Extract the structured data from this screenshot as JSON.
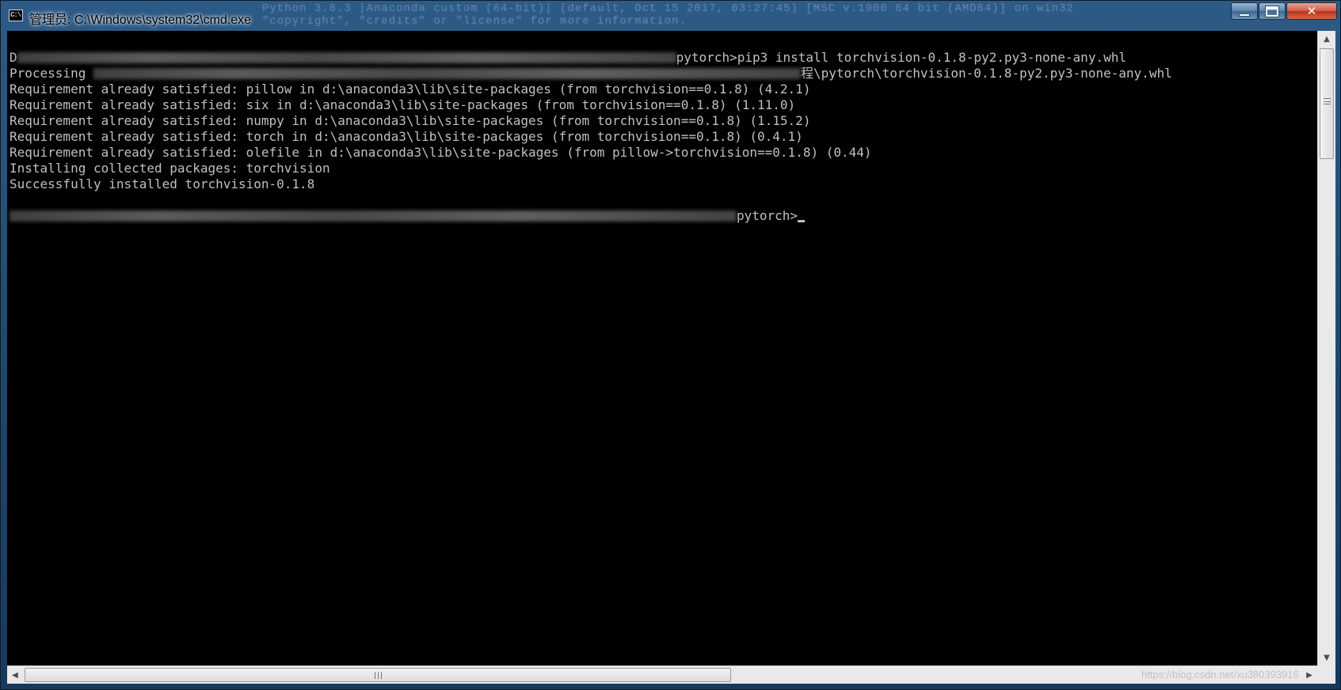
{
  "window": {
    "title": "管理员: C:\\Windows\\system32\\cmd.exe",
    "icon_label": "C:\\",
    "controls": {
      "minimize": "",
      "maximize": "",
      "close": "✕"
    },
    "background_text": "Python 3.6.3 |Anaconda custom (64-bit)| (default, Oct 15 2017, 03:27:45) [MSC v.1900 64 bit (AMD64)] on win32\n\"copyright\", \"credits\" or \"license\" for more information."
  },
  "console": {
    "lines": [
      {
        "prefix": "D",
        "suffix": "pytorch>pip3 install torchvision-0.1.8-py2.py3-none-any.whl"
      },
      {
        "prefix": "Processing ",
        "suffix": "程\\pytorch\\torchvision-0.1.8-py2.py3-none-any.whl"
      },
      {
        "text": "Requirement already satisfied: pillow in d:\\anaconda3\\lib\\site-packages (from torchvision==0.1.8) (4.2.1)"
      },
      {
        "text": "Requirement already satisfied: six in d:\\anaconda3\\lib\\site-packages (from torchvision==0.1.8) (1.11.0)"
      },
      {
        "text": "Requirement already satisfied: numpy in d:\\anaconda3\\lib\\site-packages (from torchvision==0.1.8) (1.15.2)"
      },
      {
        "text": "Requirement already satisfied: torch in d:\\anaconda3\\lib\\site-packages (from torchvision==0.1.8) (0.4.1)"
      },
      {
        "text": "Requirement already satisfied: olefile in d:\\anaconda3\\lib\\site-packages (from pillow->torchvision==0.1.8) (0.44)"
      },
      {
        "text": "Installing collected packages: torchvision"
      },
      {
        "text": "Successfully installed torchvision-0.1.8"
      },
      {
        "text": ""
      },
      {
        "prefix": "",
        "suffix": "pytorch>"
      }
    ]
  },
  "scrollbars": {
    "vertical": {
      "up_arrow": "▲",
      "down_arrow": "▼"
    },
    "horizontal": {
      "left_arrow": "◀",
      "right_arrow": "▶"
    }
  },
  "watermark": "https://blog.csdn.net/xu380393916",
  "colors": {
    "console_bg": "#000000",
    "console_fg": "#c0c0c0",
    "close_button": "#c7432a"
  }
}
